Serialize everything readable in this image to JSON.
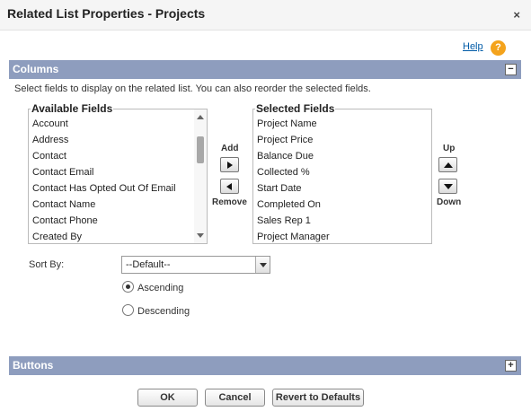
{
  "dialog": {
    "title": "Related List Properties - Projects",
    "close_glyph": "×",
    "help_label": "Help",
    "help_glyph": "?"
  },
  "columns_section": {
    "title": "Columns",
    "toggle_glyph": "−",
    "instructions": "Select fields to display on the related list. You can also reorder the selected fields."
  },
  "available": {
    "label": "Available Fields",
    "items": [
      "Account",
      "Address",
      "Contact",
      "Contact Email",
      "Contact Has Opted Out Of Email",
      "Contact Name",
      "Contact Phone",
      "Created By"
    ]
  },
  "selected": {
    "label": "Selected Fields",
    "items": [
      "Project Name",
      "Project Price",
      "Balance Due",
      "Collected %",
      "Start Date",
      "Completed On",
      "Sales Rep 1",
      "Project Manager"
    ]
  },
  "controls": {
    "add_label": "Add",
    "remove_label": "Remove",
    "up_label": "Up",
    "down_label": "Down"
  },
  "sort": {
    "label": "Sort By:",
    "value": "--Default--",
    "ascending_label": "Ascending",
    "descending_label": "Descending",
    "selected_order": "Ascending"
  },
  "buttons_section": {
    "title": "Buttons",
    "toggle_glyph": "+"
  },
  "footer": {
    "ok_label": "OK",
    "cancel_label": "Cancel",
    "revert_label": "Revert to Defaults"
  },
  "colors": {
    "section_bar": "#8e9dbe",
    "help_link": "#015ba7",
    "help_icon": "#f4a31c"
  }
}
